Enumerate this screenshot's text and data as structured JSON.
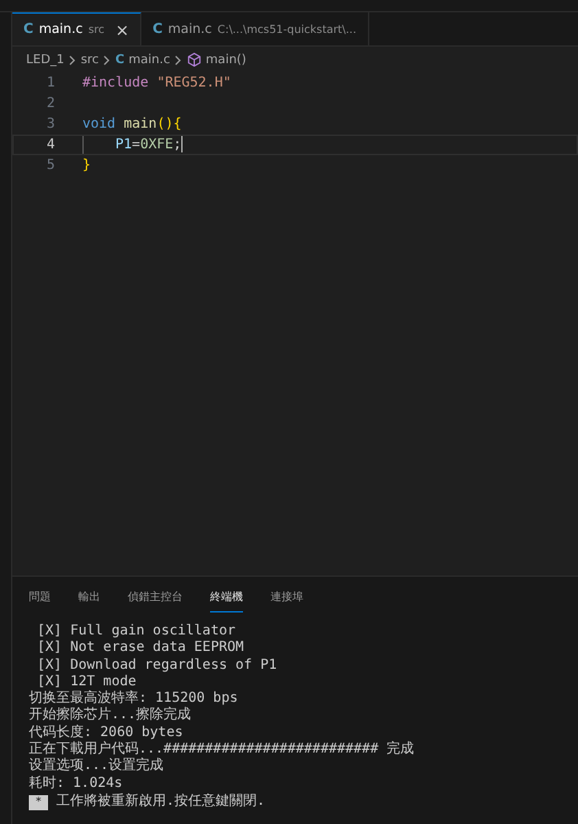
{
  "editor_tabs": [
    {
      "icon": "C",
      "name": "main.c",
      "description": "src",
      "close": "×",
      "selected": true
    },
    {
      "icon": "C",
      "name": "main.c",
      "description": "C:\\...\\mcs51-quickstart\\...",
      "selected": false
    }
  ],
  "breadcrumb": [
    {
      "kind": "folder",
      "text": "LED_1"
    },
    {
      "kind": "folder",
      "text": "src"
    },
    {
      "kind": "file",
      "icon": "C",
      "text": "main.c"
    },
    {
      "kind": "symbol",
      "text": "main()"
    }
  ],
  "code_lines": [
    {
      "number": "1",
      "current": false,
      "tokens": [
        {
          "kind": "directive",
          "text": "#include "
        },
        {
          "kind": "string",
          "text": "\"REG52.H\""
        }
      ]
    },
    {
      "number": "2",
      "current": false
    },
    {
      "number": "3",
      "current": false,
      "tokens": [
        {
          "kind": "keyword",
          "text": "void "
        },
        {
          "kind": "function",
          "text": "main"
        },
        {
          "kind": "bracket",
          "text": "(){"
        }
      ]
    },
    {
      "number": "4",
      "current": true,
      "indented": true,
      "tokens": [
        {
          "kind": "variable",
          "text": "P1"
        },
        {
          "kind": "plain",
          "text": "="
        },
        {
          "kind": "number",
          "text": "0XFE"
        },
        {
          "kind": "plain",
          "text": ";"
        }
      ]
    },
    {
      "number": "5",
      "current": false,
      "tokens": [
        {
          "kind": "bracket",
          "text": "}"
        }
      ]
    }
  ],
  "panel_tabs": [
    {
      "label": "問題",
      "selected": false
    },
    {
      "label": "輸出",
      "selected": false
    },
    {
      "label": "偵錯主控台",
      "selected": false
    },
    {
      "label": "終端機",
      "selected": true
    },
    {
      "label": "連接埠",
      "selected": false
    }
  ],
  "terminal_lines": [
    " [X] Full gain oscillator",
    " [X] Not erase data EEPROM",
    " [X] Download regardless of P1",
    " [X] 12T mode",
    "切换至最高波特率: 115200 bps",
    "开始擦除芯片...擦除完成",
    "代码长度: 2060 bytes",
    "正在下載用户代码...########################## 完成",
    "设置选项...设置完成",
    "耗时: 1.024s"
  ],
  "terminal_prompt": {
    "marker": "*",
    "text": "工作將被重新啟用.按任意鍵關閉."
  }
}
